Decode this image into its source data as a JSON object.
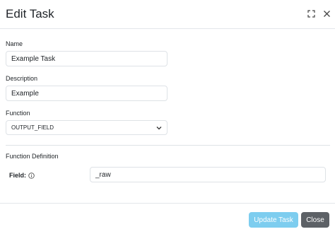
{
  "modal": {
    "title": "Edit Task"
  },
  "form": {
    "name_label": "Name",
    "name_value": "Example Task",
    "description_label": "Description",
    "description_value": "Example",
    "function_label": "Function",
    "function_value": "OUTPUT_FIELD",
    "definition_title": "Function Definition",
    "field_label": "Field:",
    "field_value": "_raw"
  },
  "footer": {
    "update_label": "Update Task",
    "close_label": "Close"
  },
  "icons": {
    "maximize": "maximize-icon",
    "close": "close-icon",
    "chevron": "chevron-down-icon",
    "info": "info-icon"
  },
  "colors": {
    "update_button": "#7dcdef",
    "close_button": "#5d6166",
    "border": "#dee2e6"
  }
}
